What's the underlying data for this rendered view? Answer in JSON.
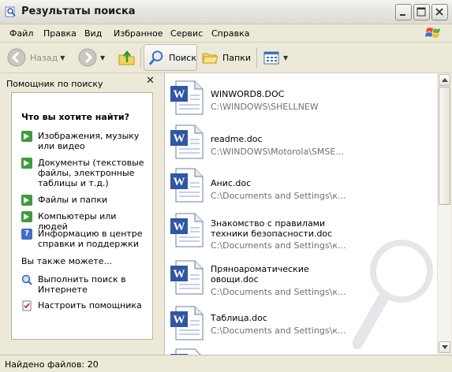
{
  "window": {
    "title": "Результаты поиска"
  },
  "menu": [
    "Файл",
    "Правка",
    "Вид",
    "Избранное",
    "Сервис",
    "Справка"
  ],
  "toolbar": {
    "back_label": "Назад",
    "search_label": "Поиск",
    "folders_label": "Папки"
  },
  "assistant": {
    "header": "Помощник по поиску",
    "question": "Что вы хотите найти?",
    "options": [
      {
        "label": "Изображения, музыку или видео",
        "icon": "green-arrow-icon"
      },
      {
        "label": "Документы (текстовые файлы, электронные таблицы и т.д.)",
        "icon": "green-arrow-icon"
      },
      {
        "label": "Файлы и папки",
        "icon": "green-arrow-icon"
      },
      {
        "label": "Компьютеры или людей",
        "icon": "green-arrow-icon"
      },
      {
        "label": "Информацию в центре справки и поддержки",
        "icon": "help-icon"
      }
    ],
    "also_header": "Вы также можете...",
    "also_options": [
      {
        "label": "Выполнить поиск в Интернете",
        "icon": "internet-search-icon"
      },
      {
        "label": "Настроить помощника",
        "icon": "settings-check-icon"
      }
    ]
  },
  "results": [
    {
      "name": "WINWORD8.DOC",
      "path": "C:\\WINDOWS\\SHELLNEW"
    },
    {
      "name": "readme.doc",
      "path": "C:\\WINDOWS\\Motorola\\SMSE..."
    },
    {
      "name": "Анис.doc",
      "path": "C:\\Documents and Settings\\к..."
    },
    {
      "name": "Знакомство с правилами техники безопасности.doc",
      "path": "C:\\Documents and Settings\\к..."
    },
    {
      "name": "Пряноароматические овощи.doc",
      "path": "C:\\Documents and Settings\\к..."
    },
    {
      "name": "Таблица.doc",
      "path": "C:\\Documents and Settings\\к..."
    }
  ],
  "status": {
    "text": "Найдено файлов: 20"
  }
}
